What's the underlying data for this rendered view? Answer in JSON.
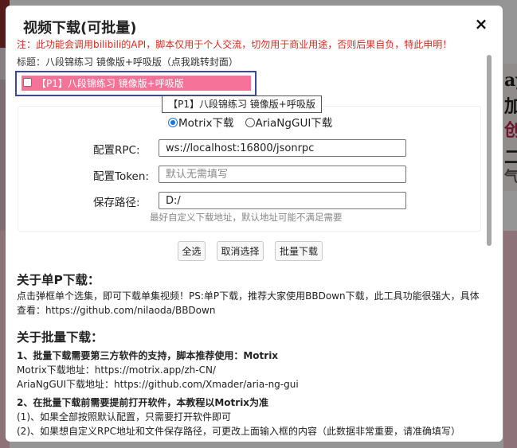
{
  "background": {
    "right_text": [
      "ay",
      "加",
      "创",
      "二",
      "气"
    ]
  },
  "dialog": {
    "title": "视频下载(可批量)",
    "close_icon": "×",
    "warning": "注：此功能会调用bilibili的API，脚本仅用于个人交流，切勿用于商业用途，否则后果自负，特此申明！",
    "video_title_label": "标题：",
    "video_title": "八段锦练习 镜像版+呼吸版",
    "cover_link": "（点我跳转封面）",
    "episode": {
      "label": "【P1】八段锦练习 镜像版+呼吸版",
      "checked": false
    },
    "tooltip": "【P1】八段锦练习 镜像版+呼吸版",
    "downloader_options": [
      {
        "label": "Motrix下载",
        "checked": true
      },
      {
        "label": "AriaNgGUI下载",
        "checked": false
      }
    ],
    "rpc": {
      "label": "配置RPC:",
      "value": "ws://localhost:16800/jsonrpc"
    },
    "token": {
      "label": "配置Token:",
      "placeholder": "默认无需填写"
    },
    "save_path": {
      "label": "保存路径:",
      "value": "D:/"
    },
    "path_hint": "最好自定义下载地址，默认地址可能不满足需要",
    "buttons": {
      "select_all": "全选",
      "deselect": "取消选择",
      "batch_download": "批量下载"
    },
    "single_section": {
      "heading": "关于单P下载：",
      "line1": "点击弹框单个选集，即可下载单集视频！PS:单P下载，推荐大家使用BBDown下载，此工具功能很强大，具体",
      "line2": "查看：https://github.com/nilaoda/BBDown"
    },
    "batch_section": {
      "heading": "关于批量下载：",
      "line1": "1、批量下载需要第三方软件的支持，脚本推荐使用：Motrix",
      "line2": "Motrix下载地址：https://motrix.app/zh-CN/",
      "line3": "AriaNgGUI下载地址：https://github.com/Xmader/aria-ng-gui",
      "line4": "2、在批量下载前需要提前打开软件，本教程以Motrix为准",
      "line5": "(1)、如果全部按照默认配置，只需要打开软件即可",
      "line6": "(2)、如果想自定义RPC地址和文件保存路径，可更改上面输入框的内容（此数据非常重要，请准确填写）"
    }
  }
}
